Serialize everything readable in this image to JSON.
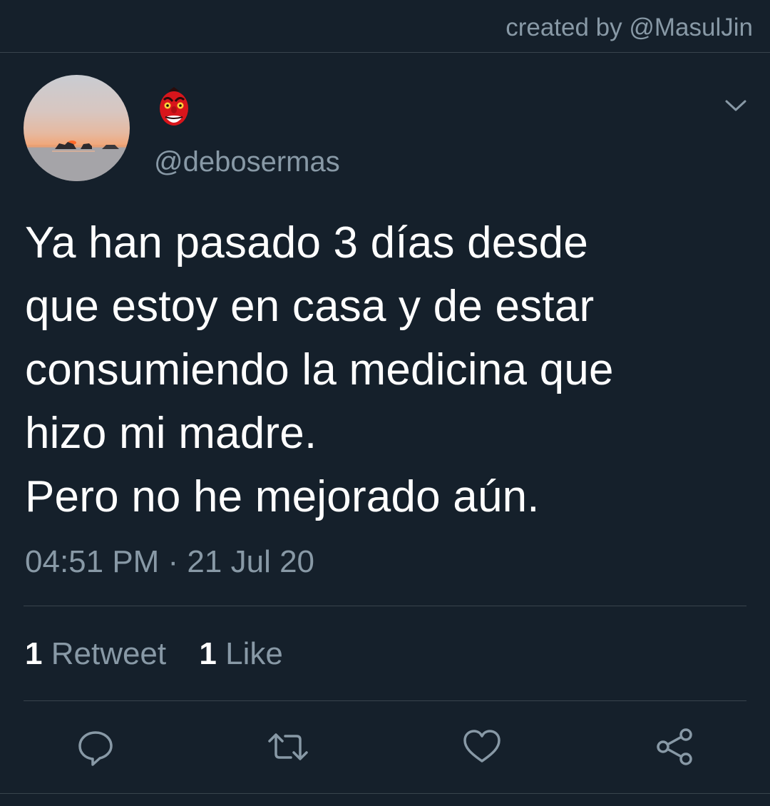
{
  "header": {
    "credit": "created by @MasulJin"
  },
  "tweet": {
    "author": {
      "avatar_icon": "sunset-photo-avatar",
      "display_icon": "tengu-mask-emoji",
      "username": "@debosermas"
    },
    "text": "Ya han pasado 3 días desde\nque estoy en casa y de estar\nconsumiendo la medicina que\nhizo mi madre.\nPero no he mejorado aún.",
    "timestamp": "04:51 PM · 21 Jul 20",
    "stats": {
      "retweet_count": "1",
      "retweet_label": "Retweet",
      "like_count": "1",
      "like_label": "Like"
    },
    "actions": [
      "reply-icon",
      "retweet-icon",
      "like-icon",
      "share-icon"
    ]
  },
  "colors": {
    "background": "#15202b",
    "secondary_text": "#8899a6",
    "divider": "#38444d",
    "primary_text": "#ffffff"
  }
}
